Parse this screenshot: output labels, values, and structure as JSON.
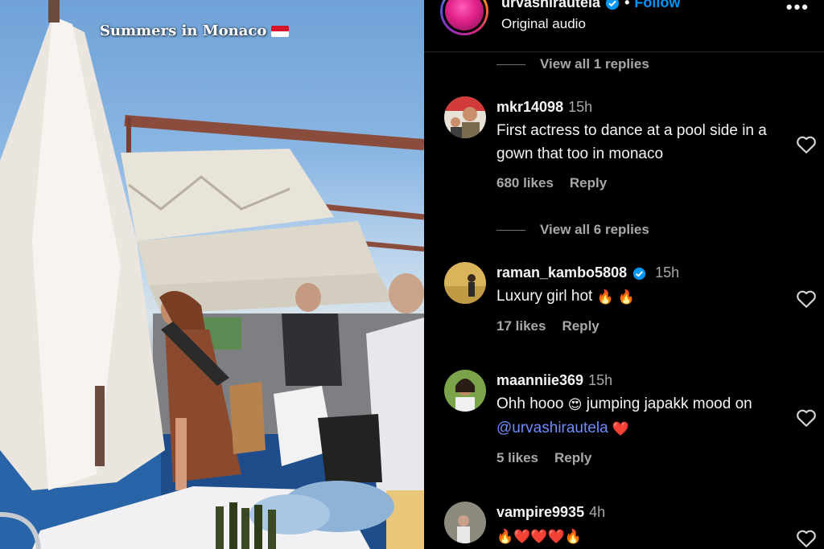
{
  "video": {
    "caption": "Summers in Monaco",
    "flag_icon": "monaco-flag-icon"
  },
  "header": {
    "username": "urvashirautela",
    "separator": "•",
    "follow_label": "Follow",
    "audio_label": "Original audio",
    "more_icon": "more-options-icon"
  },
  "replies_links": [
    {
      "label": "View all 1 replies"
    },
    {
      "label": "View all 6 replies"
    }
  ],
  "comments": [
    {
      "username": "mkr14098",
      "time": "15h",
      "text": "First actress to dance at a pool side in a gown that too in monaco",
      "likes": "680 likes",
      "reply_label": "Reply",
      "verified": false
    },
    {
      "username": "raman_kambo5808",
      "time": "15h",
      "text": "Luxury girl hot",
      "emojis": "🔥 🔥",
      "likes": "17 likes",
      "reply_label": "Reply",
      "verified": true
    },
    {
      "username": "maanniie369",
      "time": "15h",
      "text_before": "Ohh hooo",
      "emoji_mid": "😍",
      "text_after": "jumping japakk mood on",
      "mention": "@urvashirautela",
      "emoji_end": "❤️",
      "likes": "5 likes",
      "reply_label": "Reply",
      "verified": false
    },
    {
      "username": "vampire9935",
      "time": "4h",
      "emojis": "🔥❤️❤️❤️🔥",
      "verified": false
    }
  ],
  "colors": {
    "background": "#000000",
    "link_blue": "#0095f6",
    "muted_text": "#a8a8a8",
    "mention": "#6e8dff"
  }
}
